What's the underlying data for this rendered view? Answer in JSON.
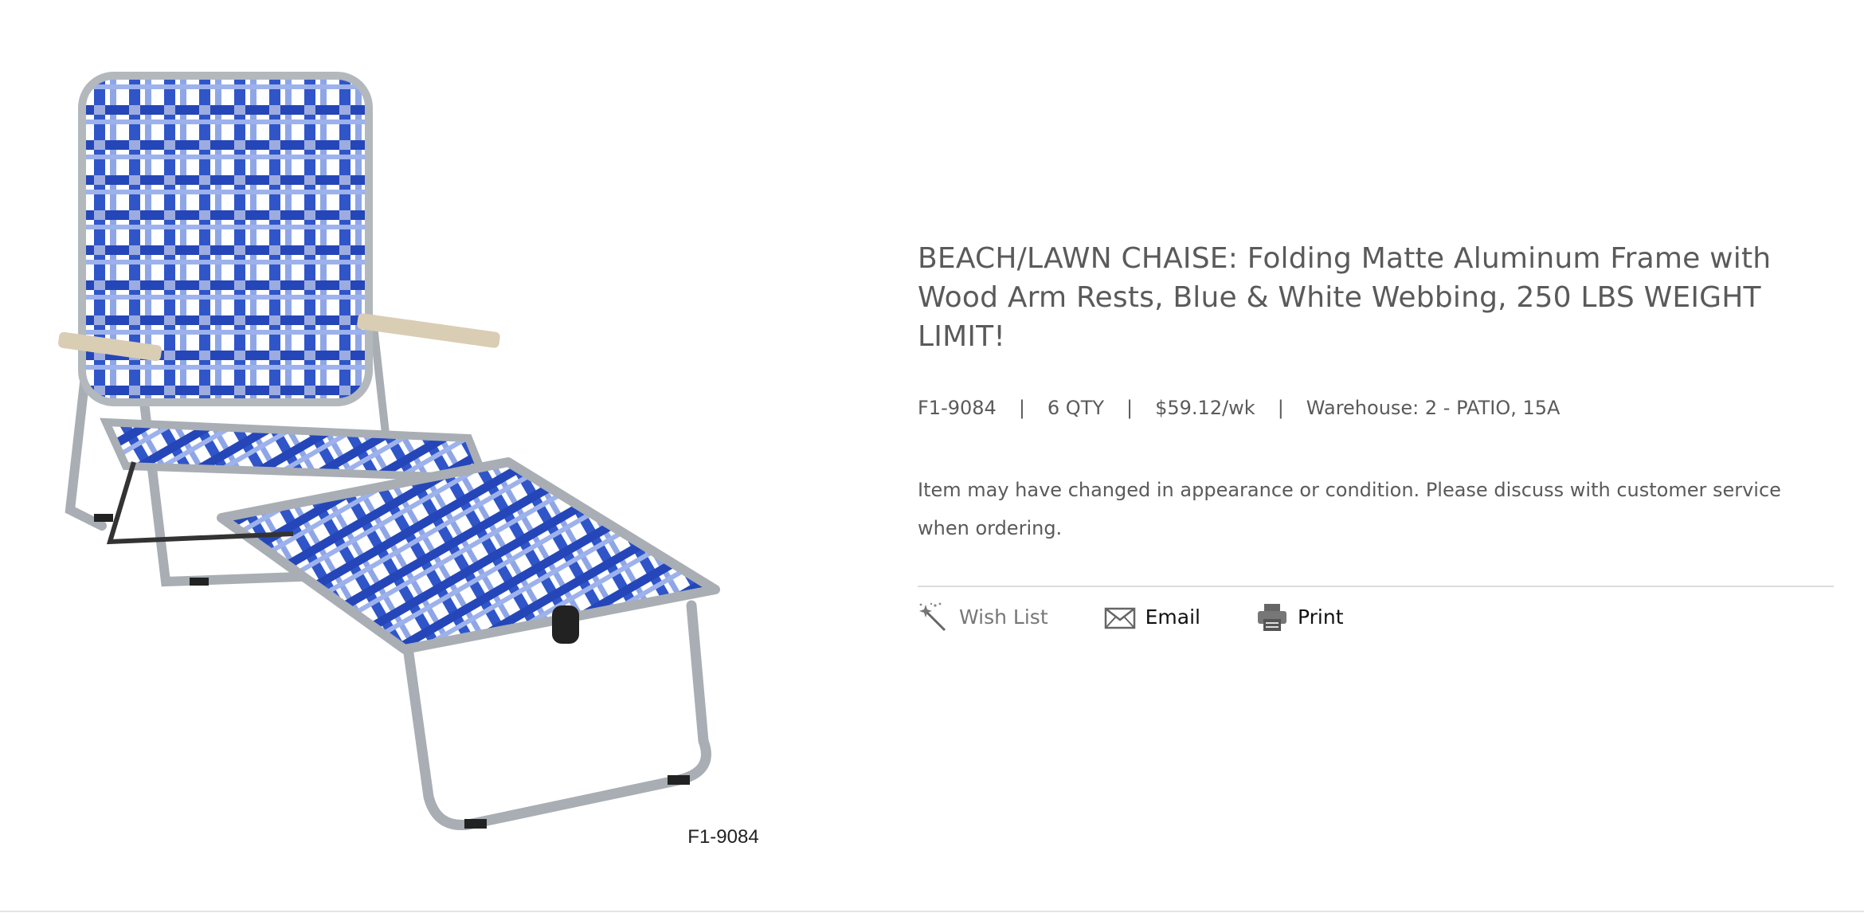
{
  "product": {
    "image_label": "F1-9084",
    "title": "BEACH/LAWN CHAISE: Folding Matte Aluminum Frame with Wood Arm Rests, Blue & White Webbing, 250 LBS WEIGHT LIMIT!",
    "sku": "F1-9084",
    "qty": "6 QTY",
    "price": "$59.12/wk",
    "warehouse": "Warehouse: 2 - PATIO, 15A",
    "separator": "|",
    "notice": "Item may have changed in appearance or condition. Please discuss with customer service when ordering."
  },
  "actions": {
    "wishlist_label": "Wish List",
    "email_label": "Email",
    "print_label": "Print",
    "icons": {
      "wishlist": "magic-wand-icon",
      "email": "envelope-icon",
      "print": "printer-icon"
    }
  },
  "colors": {
    "text": "#5a5a5a",
    "divider": "#dcdcdc",
    "webbing_blue": "#2a4fc4",
    "webbing_white": "#ffffff",
    "frame": "#a9aeb4",
    "armrest_wood": "#d9cdb4"
  }
}
